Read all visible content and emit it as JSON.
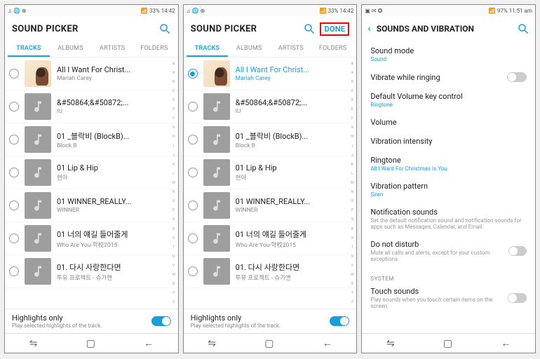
{
  "status": {
    "left_icons": "♫ 🌐 ⊕",
    "battery": "33%",
    "time": "14:42",
    "misc": "📶"
  },
  "status_right": {
    "left_icons": "▣ ✉ ✪",
    "battery": "97%",
    "time": "11:51 am",
    "misc": "📶"
  },
  "picker_title": "SOUND PICKER",
  "done_label": "DONE",
  "tabs": [
    "TRACKS",
    "ALBUMS",
    "ARTISTS",
    "FOLDERS"
  ],
  "abc": [
    "&",
    "A",
    "B",
    "C",
    "D",
    "E",
    "F",
    "G",
    "H",
    "I",
    "J",
    "K",
    "L",
    "M",
    "N",
    "O",
    "P",
    "Q",
    "R",
    "S",
    "T",
    "U",
    "V",
    "W",
    "X",
    "Y",
    "Z"
  ],
  "tracks": [
    {
      "title": "All I Want For Christ...",
      "artist": "Mariah Carey",
      "cover": true
    },
    {
      "title": "&#50864;&#50872;...",
      "artist": "IU",
      "cover": false
    },
    {
      "title": "01 _블락비 (BlockB)...",
      "artist": "Block B",
      "cover": false
    },
    {
      "title": "01 Lip & Hip",
      "artist": "현아",
      "cover": false
    },
    {
      "title": "01 WINNER_REALLY...",
      "artist": "WINNER",
      "cover": false
    },
    {
      "title": "01 너의 얘길 들어줄게",
      "artist": "Who Are You-학校2015",
      "cover": false
    },
    {
      "title": "01. 다시 사랑한다면",
      "artist": "투유 프로젝트 - 슈가맨",
      "cover": false
    }
  ],
  "highlights": {
    "title": "Highlights only",
    "sub": "Play selected highlights of the track."
  },
  "settings": {
    "title": "SOUNDS AND VIBRATION",
    "rows": [
      {
        "title": "Sound mode",
        "sub": "Sound",
        "subClass": ""
      },
      {
        "title": "Vibrate while ringing",
        "toggle": "off"
      },
      {
        "title": "Default Volume key control",
        "sub": "Ringtone",
        "subClass": ""
      },
      {
        "title": "Volume"
      },
      {
        "title": "Vibration intensity"
      },
      {
        "title": "Ringtone",
        "sub": "All I Want For Christmas Is You",
        "subClass": ""
      },
      {
        "title": "Vibration pattern",
        "sub": "Siren",
        "subClass": ""
      },
      {
        "title": "Notification sounds",
        "sub": "Set the default notification sound and notification sounds for apps such as Messages, Calendar, and Email.",
        "subClass": "gray"
      },
      {
        "title": "Do not disturb",
        "sub": "Mute all calls and alerts, except for your custom exceptions.",
        "subClass": "gray",
        "toggle": "off"
      }
    ],
    "system_label": "SYSTEM",
    "touch": {
      "title": "Touch sounds",
      "sub": "Play sounds when you touch certain items on the screen.",
      "toggle": "off"
    }
  },
  "nav": {
    "recent": "⇋",
    "home": "▢",
    "back": "←"
  }
}
